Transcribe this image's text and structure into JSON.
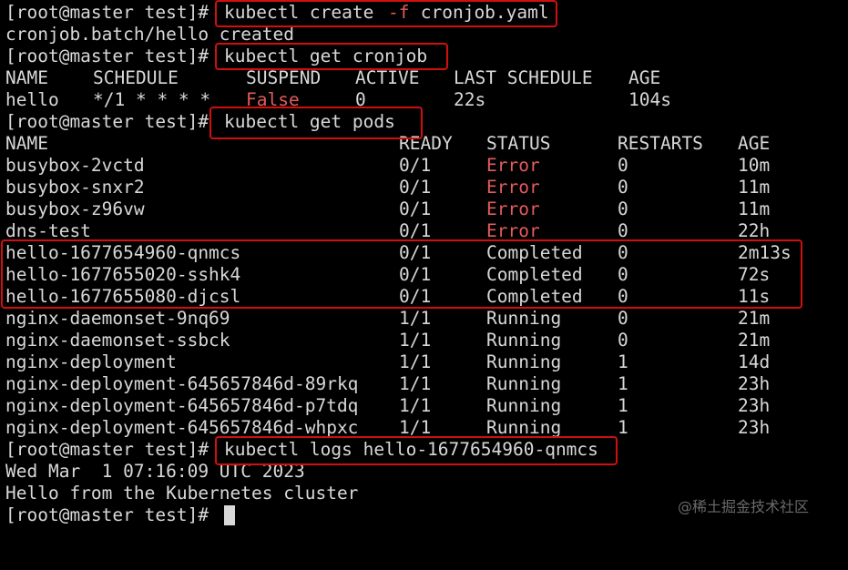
{
  "terminal": {
    "prompt": "[root@master test]#",
    "cmd_create": {
      "cmd": "kubectl create ",
      "flag": "-f",
      "arg": " cronjob.yaml"
    },
    "create_output": "cronjob.batch/hello created",
    "cmd_get_cronjob": "kubectl get cronjob",
    "cronjob_table": {
      "headers": [
        "NAME",
        "SCHEDULE",
        "SUSPEND",
        "ACTIVE",
        "LAST SCHEDULE",
        "AGE"
      ],
      "row": [
        "hello",
        "*/1 * * * *",
        "False",
        "0",
        "22s",
        "104s"
      ]
    },
    "cmd_get_pods": "kubectl get pods",
    "pods_table": {
      "headers": [
        "NAME",
        "READY",
        "STATUS",
        "RESTARTS",
        "AGE"
      ],
      "rows": [
        [
          "busybox-2vctd",
          "0/1",
          "Error",
          "0",
          "10m"
        ],
        [
          "busybox-snxr2",
          "0/1",
          "Error",
          "0",
          "11m"
        ],
        [
          "busybox-z96vw",
          "0/1",
          "Error",
          "0",
          "11m"
        ],
        [
          "dns-test",
          "0/1",
          "Error",
          "0",
          "22h"
        ],
        [
          "hello-1677654960-qnmcs",
          "0/1",
          "Completed",
          "0",
          "2m13s"
        ],
        [
          "hello-1677655020-sshk4",
          "0/1",
          "Completed",
          "0",
          "72s"
        ],
        [
          "hello-1677655080-djcsl",
          "0/1",
          "Completed",
          "0",
          "11s"
        ],
        [
          "nginx-daemonset-9nq69",
          "1/1",
          "Running",
          "0",
          "21m"
        ],
        [
          "nginx-daemonset-ssbck",
          "1/1",
          "Running",
          "0",
          "21m"
        ],
        [
          "nginx-deployment",
          "1/1",
          "Running",
          "1",
          "14d"
        ],
        [
          "nginx-deployment-645657846d-89rkq",
          "1/1",
          "Running",
          "1",
          "23h"
        ],
        [
          "nginx-deployment-645657846d-p7tdq",
          "1/1",
          "Running",
          "1",
          "23h"
        ],
        [
          "nginx-deployment-645657846d-whpxc",
          "1/1",
          "Running",
          "1",
          "23h"
        ]
      ]
    },
    "cmd_logs": "kubectl logs hello-1677654960-qnmcs",
    "log_lines": [
      "Wed Mar  1 07:16:09 UTC 2023",
      "Hello from the Kubernetes cluster"
    ]
  },
  "watermark": "@稀土掘金技术社区",
  "colors": {
    "background": "#000000",
    "text": "#d8d8d8",
    "error": "#e45b5b",
    "highlight_box": "#d10f0f"
  }
}
